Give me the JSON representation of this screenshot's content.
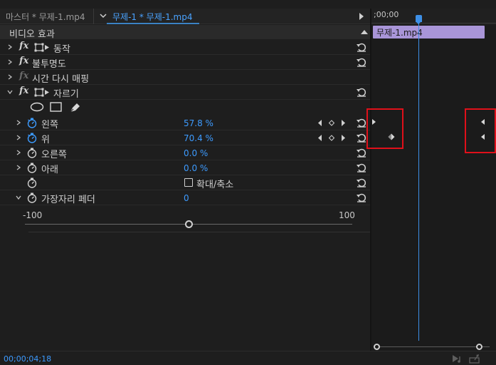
{
  "tabs": {
    "master": "마스터 * 무제-1.mp4",
    "active": "무제-1 * 무제-1.mp4"
  },
  "panel": {
    "title": "비디오 효과"
  },
  "effects": [
    {
      "label": "동작",
      "fx": "fx"
    },
    {
      "label": "불투명도",
      "fx": "fx"
    },
    {
      "label": "시간 다시 매핑"
    },
    {
      "label": "자르기",
      "fx": "fx"
    }
  ],
  "crop": {
    "left": {
      "label": "왼쪽",
      "value": "57.8 %"
    },
    "top": {
      "label": "위",
      "value": "70.4 %"
    },
    "right": {
      "label": "오른쪽",
      "value": "0.0 %"
    },
    "bottom": {
      "label": "아래",
      "value": "0.0 %"
    },
    "zoom": {
      "label": "확대/축소",
      "checked": false
    },
    "feather": {
      "label": "가장자리 페더",
      "value": "0"
    }
  },
  "slider": {
    "min": "-100",
    "max": "100",
    "level_fraction": 0.5
  },
  "timeline": {
    "timecode": ";00;00",
    "clip_name": "무제-1.mp4",
    "clip_color": "#a995d8",
    "playhead_color": "#3d8fe6"
  },
  "status": {
    "timecode": "00;00;04;18"
  },
  "colors": {
    "accent": "#3d9bff",
    "highlight": "#e0101a"
  }
}
